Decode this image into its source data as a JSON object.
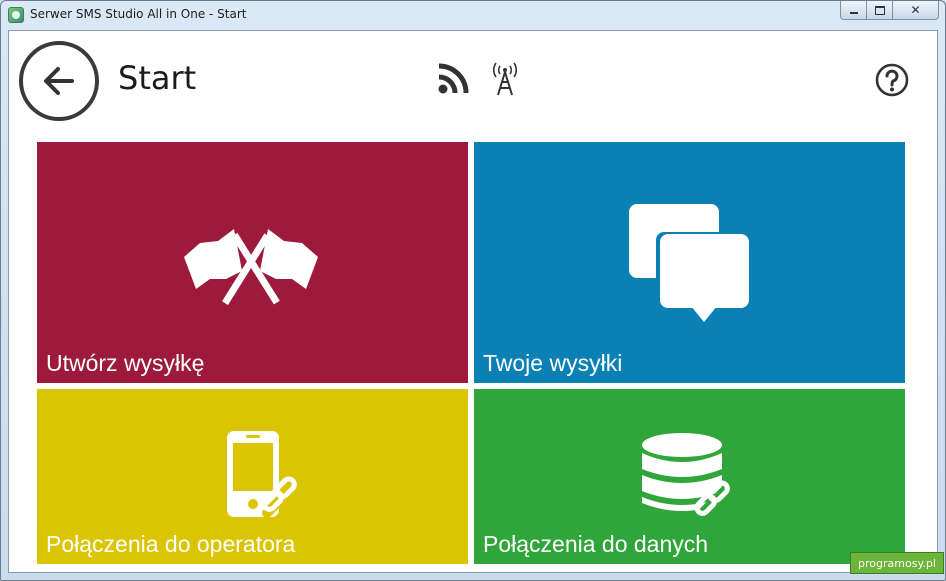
{
  "window": {
    "title": "Serwer SMS Studio All in One - Start",
    "buttons": {
      "minimize": "minimize",
      "maximize": "maximize",
      "close": "close"
    }
  },
  "header": {
    "back_icon": "arrow-left-icon",
    "title": "Start",
    "status_icons": [
      "rss-icon",
      "antenna-icon"
    ],
    "help_icon": "question-mark-icon"
  },
  "tiles": [
    {
      "label": "Utwórz wysyłkę",
      "icon": "crossed-flags-icon",
      "color": "#9d1a3d"
    },
    {
      "label": "Twoje wysyłki",
      "icon": "chat-bubbles-icon",
      "color": "#0a80b4"
    },
    {
      "label": "Połączenia do operatora",
      "icon": "phone-link-icon",
      "color": "#dbc500"
    },
    {
      "label": "Połączenia do danych",
      "icon": "database-link-icon",
      "color": "#30a63a"
    }
  ],
  "watermark": "programosy.pl"
}
